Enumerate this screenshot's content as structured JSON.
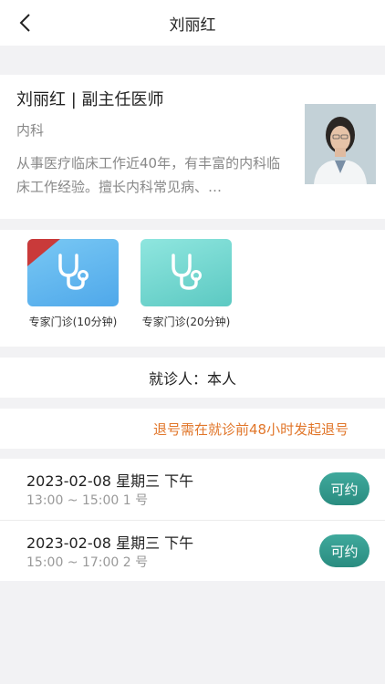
{
  "header": {
    "title": "刘丽红"
  },
  "doctor": {
    "name_title": "刘丽红 | 副主任医师",
    "department": "内科",
    "description": "从事医疗临床工作近40年，有丰富的内科临床工作经验。擅长内科常见病、…"
  },
  "services": [
    {
      "label": "专家门诊(10分钟)",
      "icon": "stethoscope-icon",
      "color": "#5aaeee"
    },
    {
      "label": "专家门诊(20分钟)",
      "icon": "stethoscope-icon",
      "color": "#6fd2cb"
    }
  ],
  "patient": {
    "text": "就诊人：本人"
  },
  "notice": {
    "text": "退号需在就诊前48小时发起退号"
  },
  "slots": [
    {
      "date": "2023-02-08 星期三 下午",
      "time": "13:00 ~ 15:00 1 号",
      "button": "可约"
    },
    {
      "date": "2023-02-08 星期三 下午",
      "time": "15:00 ~ 17:00 2 号",
      "button": "可约"
    }
  ],
  "colors": {
    "accent": "#2f9a8e",
    "notice": "#e1762a",
    "badge": "#c93a3a"
  }
}
